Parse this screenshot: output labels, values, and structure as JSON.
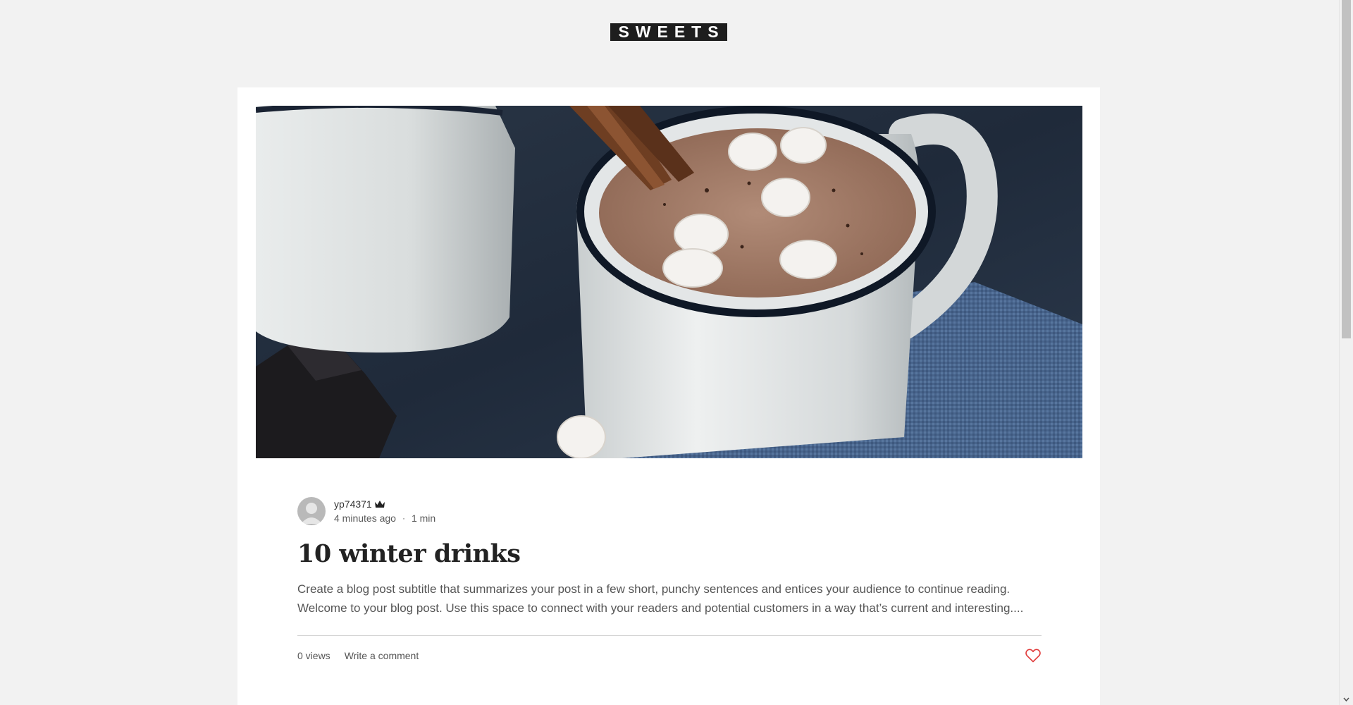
{
  "site": {
    "logo_text": "SWEETS"
  },
  "post": {
    "image_alt": "Mugs of hot chocolate with marshmallows and cinnamon sticks",
    "author": "yp74371",
    "time_ago": "4 minutes ago",
    "separator": "·",
    "read_time": "1 min",
    "title": "10 winter drinks",
    "excerpt_line1": "Create a blog post subtitle that summarizes your post in a few short, punchy sentences and entices your audience to continue reading.",
    "excerpt_line2": "Welcome to your blog post. Use this space to connect with your readers and potential customers in a way that’s current and interesting....",
    "views": "0 views",
    "comment_label": "Write a comment"
  },
  "colors": {
    "background": "#f2f2f2",
    "card": "#ffffff",
    "logo_bg": "#1e1e1e",
    "heart": "#e03a3a"
  },
  "icons": {
    "author_badge": "crown-icon",
    "like": "heart-icon",
    "avatar": "user-avatar-icon"
  }
}
